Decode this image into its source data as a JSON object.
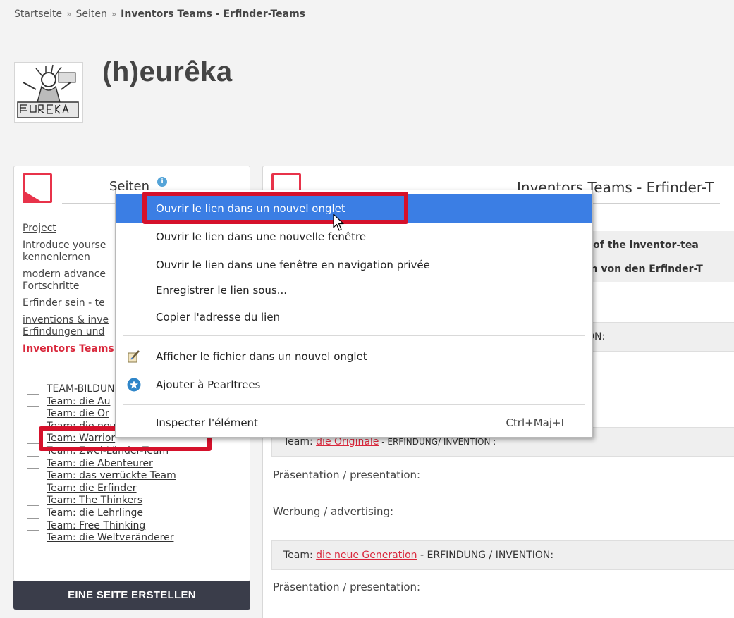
{
  "breadcrumb": {
    "home": "Startseite",
    "separator": "»",
    "pages": "Seiten",
    "current": "Inventors Teams - Erfinder-Teams"
  },
  "site": {
    "title": "(h)eurêka"
  },
  "sidebar": {
    "title": "Seiten",
    "info_icon": "i",
    "items": [
      {
        "label": "Project"
      },
      {
        "label": "Introduce yourse"
      },
      {
        "label": "kennenlernen"
      },
      {
        "label": "modern advance"
      },
      {
        "label": "Fortschritte"
      },
      {
        "label": "Erfinder sein - te"
      },
      {
        "label": "inventions & inve"
      },
      {
        "label": "Erfindungen und"
      },
      {
        "label": "Inventors Teams"
      }
    ],
    "subitems": [
      {
        "label": "TEAM-BILDUN"
      },
      {
        "label": "Team: die Au"
      },
      {
        "label": "Team: die Or"
      },
      {
        "label": "Team: die neue Generation"
      },
      {
        "label": "Team: Warrior"
      },
      {
        "label": "Team: Zwei-Länder-Team"
      },
      {
        "label": "Team: die Abenteurer"
      },
      {
        "label": "Team: das verrückte Team"
      },
      {
        "label": "Team: die Erfinder"
      },
      {
        "label": "Team: The Thinkers"
      },
      {
        "label": "Team: die Lehrlinge"
      },
      {
        "label": "Team: Free Thinking"
      },
      {
        "label": "Team: die Weltveränderer"
      }
    ],
    "create_button": "EINE SEITE ERSTELLEN"
  },
  "main": {
    "title": "Inventors Teams - Erfinder-T",
    "intro_line1": "ns of the inventor-tea",
    "intro_line2": "gen von den Erfinder-T",
    "partial_label": "ON:",
    "team_box_1": {
      "prefix": "Team: ",
      "link": "die Originale",
      "suffix": " - ERFINDUNG/ INVENTION :"
    },
    "presentation_1": "Präsentation / presentation:",
    "advertising_1": "Werbung / advertising:",
    "team_box_2": {
      "prefix": "Team: ",
      "link": "die neue Generation",
      "suffix": " - ERFINDUNG / INVENTION:"
    },
    "presentation_2": "Präsentation / presentation:"
  },
  "context_menu": {
    "items": [
      {
        "label": "Ouvrir le lien dans un nouvel onglet",
        "selected": true
      },
      {
        "label": "Ouvrir le lien dans une nouvelle fenêtre"
      },
      {
        "label": "Ouvrir le lien dans une fenêtre en navigation privée"
      },
      {
        "label": "Enregistrer le lien sous..."
      },
      {
        "label": "Copier l'adresse du lien"
      },
      {
        "label": "Afficher le fichier dans un nouvel onglet",
        "icon": "brush-file-icon"
      },
      {
        "label": "Ajouter à Pearltrees",
        "icon": "pearltrees-star-icon"
      },
      {
        "label": "Inspecter l'élément",
        "shortcut": "Ctrl+Maj+I"
      }
    ]
  },
  "colors": {
    "accent_red": "#d9283c",
    "highlight_red": "#d5112b",
    "menu_selected": "#3b7ee4",
    "button_dark": "#3a3d4a"
  }
}
